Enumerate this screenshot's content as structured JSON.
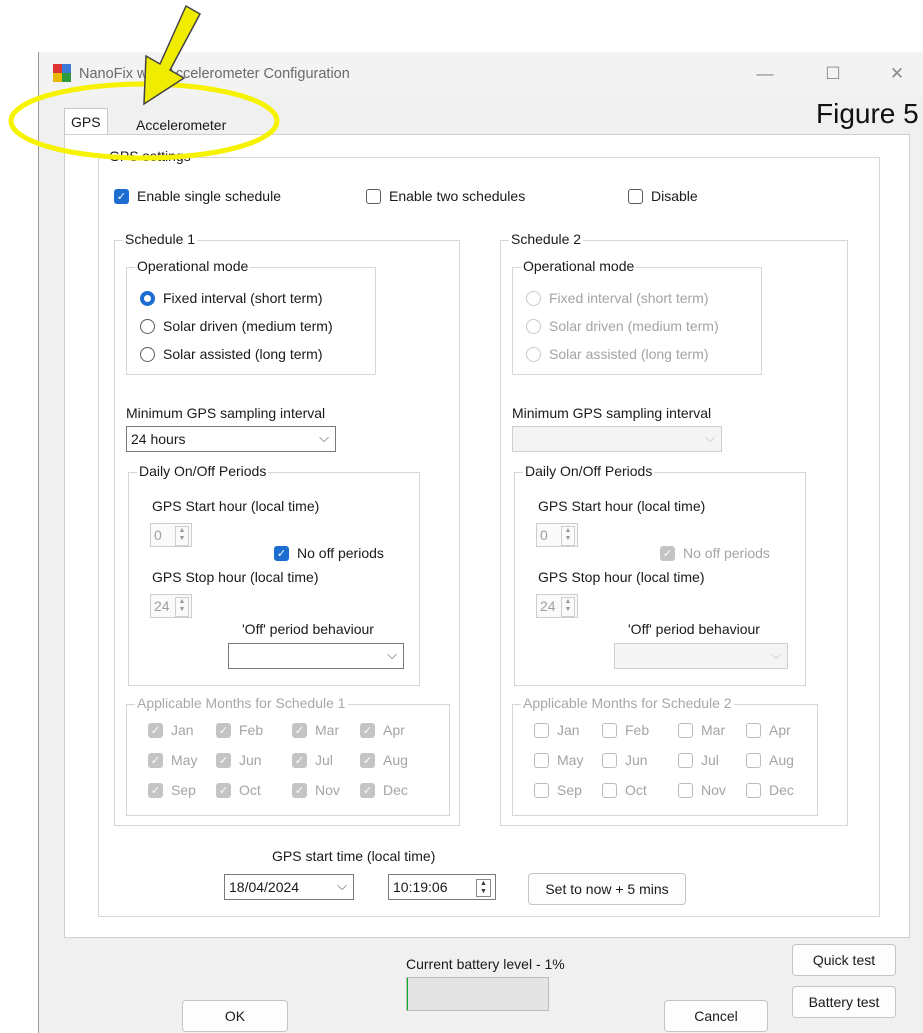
{
  "window": {
    "title": "NanoFix with Accelerometer Configuration",
    "controls": [
      "—",
      "☐",
      "✕"
    ]
  },
  "annotation": {
    "figure_label": "Figure 5",
    "arrow_color": "#f0ec00",
    "highlight_color": "#f6f200"
  },
  "tabs": [
    {
      "label": "GPS",
      "active": true
    },
    {
      "label": "Accelerometer",
      "active": false
    }
  ],
  "gps_settings": {
    "legend": "GPS settings",
    "schedule_options": [
      {
        "label": "Enable single schedule",
        "checked": true
      },
      {
        "label": "Enable two schedules",
        "checked": false
      },
      {
        "label": "Disable",
        "checked": false
      }
    ],
    "schedule1": {
      "legend": "Schedule 1",
      "operational_mode": {
        "legend": "Operational mode",
        "options": [
          {
            "label": "Fixed interval (short term)",
            "checked": true
          },
          {
            "label": "Solar driven (medium term)",
            "checked": false
          },
          {
            "label": "Solar assisted (long term)",
            "checked": false
          }
        ]
      },
      "min_sampling_label": "Minimum GPS sampling interval",
      "min_sampling_value": "24 hours",
      "daily": {
        "legend": "Daily On/Off Periods",
        "start_label": "GPS Start hour (local time)",
        "start_value": "0",
        "no_off_label": "No off periods",
        "stop_label": "GPS Stop hour (local time)",
        "stop_value": "24",
        "off_behaviour_label": "'Off' period behaviour",
        "off_behaviour_value": ""
      },
      "months": {
        "legend": "Applicable Months for Schedule 1",
        "items": [
          "Jan",
          "Feb",
          "Mar",
          "Apr",
          "May",
          "Jun",
          "Jul",
          "Aug",
          "Sep",
          "Oct",
          "Nov",
          "Dec"
        ]
      }
    },
    "schedule2": {
      "legend": "Schedule 2",
      "operational_mode": {
        "legend": "Operational mode",
        "options": [
          {
            "label": "Fixed interval (short term)"
          },
          {
            "label": "Solar driven (medium term)"
          },
          {
            "label": "Solar assisted (long term)"
          }
        ]
      },
      "min_sampling_label": "Minimum GPS sampling interval",
      "min_sampling_value": "",
      "daily": {
        "legend": "Daily On/Off Periods",
        "start_label": "GPS Start hour (local time)",
        "start_value": "0",
        "no_off_label": "No off periods",
        "stop_label": "GPS Stop hour (local time)",
        "stop_value": "24",
        "off_behaviour_label": "'Off' period behaviour",
        "off_behaviour_value": ""
      },
      "months": {
        "legend": "Applicable Months for Schedule 2",
        "items": [
          "Jan",
          "Feb",
          "Mar",
          "Apr",
          "May",
          "Jun",
          "Jul",
          "Aug",
          "Sep",
          "Oct",
          "Nov",
          "Dec"
        ]
      }
    },
    "start_time": {
      "label": "GPS start time (local time)",
      "date": "18/04/2024",
      "time": "10:19:06",
      "set_now_label": "Set to now + 5 mins"
    }
  },
  "footer": {
    "battery_label": "Current battery level - 1%",
    "battery_level": 0.01,
    "ok_label": "OK",
    "cancel_label": "Cancel",
    "quick_test_label": "Quick test",
    "battery_test_label": "Battery test"
  }
}
